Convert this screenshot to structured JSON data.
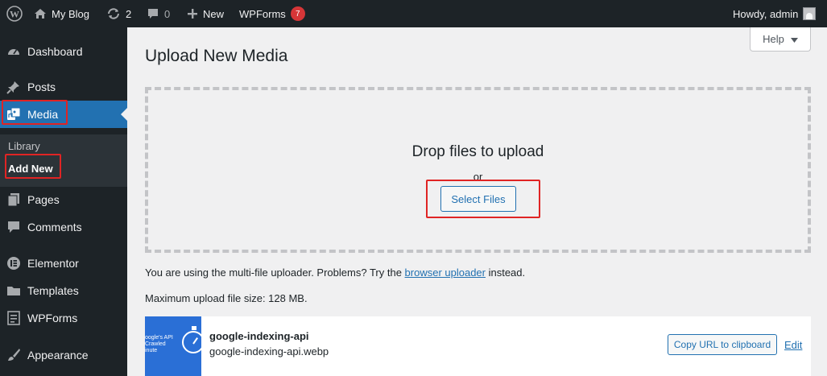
{
  "adminbar": {
    "wp_logo_icon": "wordpress-logo-icon",
    "site_name": "My Blog",
    "updates_count": "2",
    "comments_count": "0",
    "new_label": "New",
    "wpforms_label": "WPForms",
    "wpforms_count": "7",
    "howdy": "Howdy, admin"
  },
  "sidebar": {
    "items": [
      {
        "label": "Dashboard",
        "icon": "dashboard-icon"
      },
      {
        "label": "Posts",
        "icon": "pin-icon"
      },
      {
        "label": "Media",
        "icon": "media-icon"
      },
      {
        "label": "Pages",
        "icon": "pages-icon"
      },
      {
        "label": "Comments",
        "icon": "comments-icon"
      },
      {
        "label": "Elementor",
        "icon": "elementor-icon"
      },
      {
        "label": "Templates",
        "icon": "folder-icon"
      },
      {
        "label": "WPForms",
        "icon": "wpforms-icon"
      },
      {
        "label": "Appearance",
        "icon": "paintbrush-icon"
      }
    ],
    "submenu": [
      {
        "label": "Library"
      },
      {
        "label": "Add New"
      }
    ]
  },
  "help": {
    "label": "Help"
  },
  "page": {
    "title": "Upload New Media",
    "drop_title": "Drop files to upload",
    "drop_or": "or",
    "select_files": "Select Files",
    "uploader_text_before": "You are using the multi-file uploader. Problems? Try the ",
    "uploader_link": "browser uploader",
    "uploader_text_after": " instead.",
    "max_size": "Maximum upload file size: 128 MB."
  },
  "media_item": {
    "thumb_lines": [
      "oogle's API",
      "Crawled",
      "inute"
    ],
    "title": "google-indexing-api",
    "filename": "google-indexing-api.webp",
    "copy_label": "Copy URL to clipboard",
    "edit_label": "Edit"
  },
  "colors": {
    "accent": "#2271b1",
    "highlight_box": "#e02424",
    "adminbar_bg": "#1d2327",
    "badge": "#d63638"
  }
}
